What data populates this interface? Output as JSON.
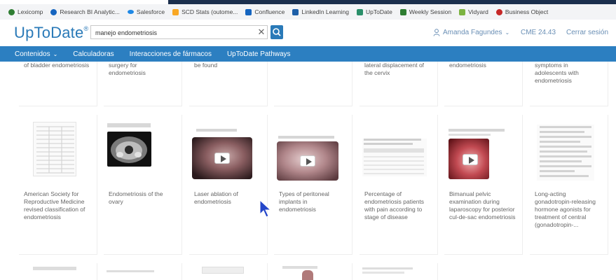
{
  "bookmarks": [
    {
      "label": "Lexicomp",
      "color": "#2e7d32",
      "icon": "lexicomp-icon"
    },
    {
      "label": "Research BI Analytic...",
      "color": "#1565c0",
      "icon": "research-icon"
    },
    {
      "label": "Salesforce",
      "color": "#1e88e5",
      "icon": "salesforce-icon"
    },
    {
      "label": "SCD Stats (outome...",
      "color": "#f9a825",
      "icon": "stats-icon"
    },
    {
      "label": "Confluence",
      "color": "#1565c0",
      "icon": "confluence-icon"
    },
    {
      "label": "LinkedIn Learning",
      "color": "#1e5fa8",
      "icon": "linkedin-icon"
    },
    {
      "label": "UpToDate",
      "color": "#2a8f6a",
      "icon": "uptodate-icon"
    },
    {
      "label": "Weekly Session",
      "color": "#2e7d32",
      "icon": "weekly-icon"
    },
    {
      "label": "Vidyard",
      "color": "#7cb342",
      "icon": "vidyard-icon"
    },
    {
      "label": "Business Object",
      "color": "#c62828",
      "icon": "business-object-icon"
    }
  ],
  "header": {
    "logo": "UpToDate",
    "search_value": "manejo endometriosis",
    "user_name": "Amanda Fagundes",
    "cme": "CME 24.43",
    "logout": "Cerrar sesión"
  },
  "nav": {
    "items": [
      "Contenidos",
      "Calculadoras",
      "Interacciones de fármacos",
      "UpToDate Pathways"
    ]
  },
  "top_row": [
    "of bladder endometriosis",
    "surgery for endometriosis",
    "be found",
    "",
    "lateral displacement of the cervix",
    "endometriosis",
    "symptoms in adolescents with endometriosis"
  ],
  "mid_row": [
    "American Society for Reproductive Medicine revised classification of endometriosis",
    "Endometriosis of the ovary",
    "Laser ablation of endometriosis",
    "Types of peritoneal implants in endometriosis",
    "Percentage of endometriosis patients with pain according to stage of disease",
    "Bimanual pelvic examination during laparoscopy for posterior cul-de-sac endometriosis",
    "Long-acting gonadotropin-releasing hormone agonists for treatment of central (gonadotropin-..."
  ],
  "colors": {
    "brand_blue": "#2a7ab8",
    "nav_blue": "#2c7fc1",
    "link_text": "#6a8fb5"
  }
}
